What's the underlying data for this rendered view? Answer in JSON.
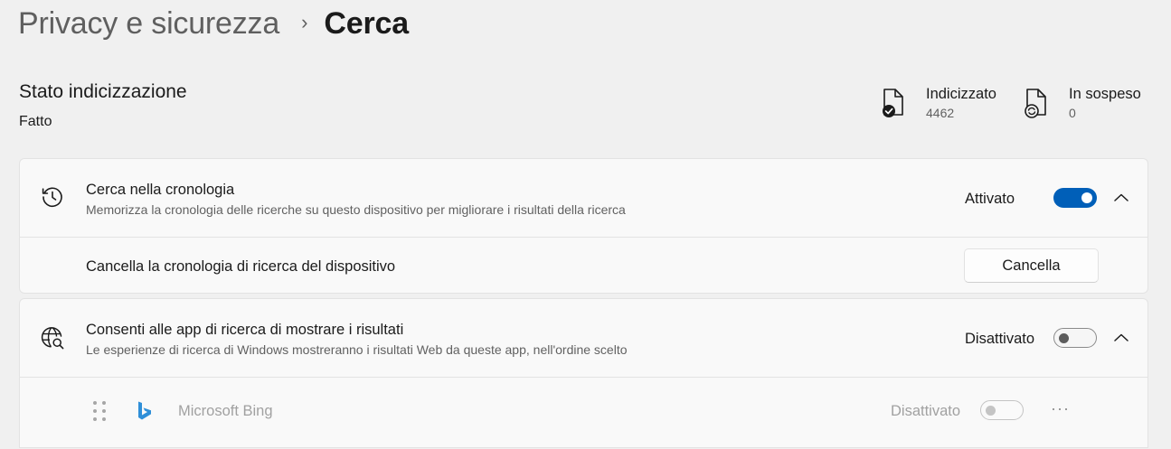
{
  "breadcrumb": {
    "parent": "Privacy e sicurezza",
    "separator": "›",
    "current": "Cerca"
  },
  "indexing": {
    "title": "Stato indicizzazione",
    "status": "Fatto",
    "indexed": {
      "label": "Indicizzato",
      "value": "4462",
      "icon": "indexed-file-icon"
    },
    "pending": {
      "label": "In sospeso",
      "value": "0",
      "icon": "pending-file-icon"
    }
  },
  "history": {
    "icon": "history-icon",
    "title": "Cerca nella cronologia",
    "subtitle": "Memorizza la cronologia delle ricerche su questo dispositivo per migliorare i risultati della ricerca",
    "state": "Attivato",
    "toggle_on": true,
    "clear_label": "Cancella la cronologia di ricerca del dispositivo",
    "clear_button": "Cancella"
  },
  "apps": {
    "icon": "globe-search-icon",
    "title": "Consenti alle app di ricerca di mostrare i risultati",
    "subtitle": "Le esperienze di ricerca di Windows mostreranno i risultati Web da queste app, nell'ordine scelto",
    "state": "Disattivato",
    "toggle_on": false,
    "items": [
      {
        "name": "Microsoft Bing",
        "state": "Disattivato",
        "icon": "bing-icon",
        "more": "···"
      }
    ]
  },
  "colors": {
    "accent": "#005fb8",
    "background": "#f0f0f0",
    "card": "#f9f9f9"
  }
}
